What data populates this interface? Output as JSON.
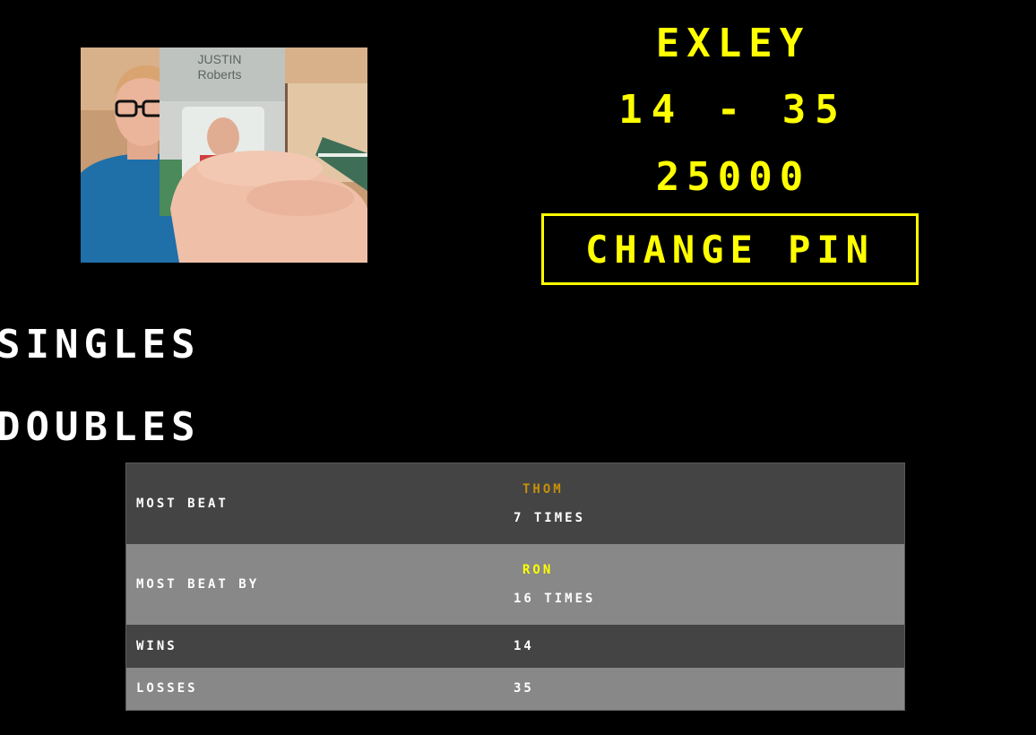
{
  "player": {
    "name": "EXLEY",
    "record": "14 - 35",
    "rating": "25000",
    "photo_badge_line1": "JUSTIN",
    "photo_badge_line2": "Roberts"
  },
  "actions": {
    "change_pin_label": "CHANGE PIN"
  },
  "modes": {
    "singles_label": "SINGLES",
    "doubles_label": "DOUBLES"
  },
  "stats": {
    "rows": [
      {
        "label": "MOST BEAT",
        "opponent": "THOM",
        "opponent_color": "#c8900a",
        "times": "7 TIMES"
      },
      {
        "label": "MOST BEAT BY",
        "opponent": "RON",
        "opponent_color": "#ffff00",
        "times": "16 TIMES"
      },
      {
        "label": "WINS",
        "value": "14"
      },
      {
        "label": "LOSSES",
        "value": "35"
      }
    ]
  },
  "colors": {
    "accent": "#ffff00",
    "background": "#000000",
    "row_dark": "#444444",
    "row_light": "#888888"
  }
}
